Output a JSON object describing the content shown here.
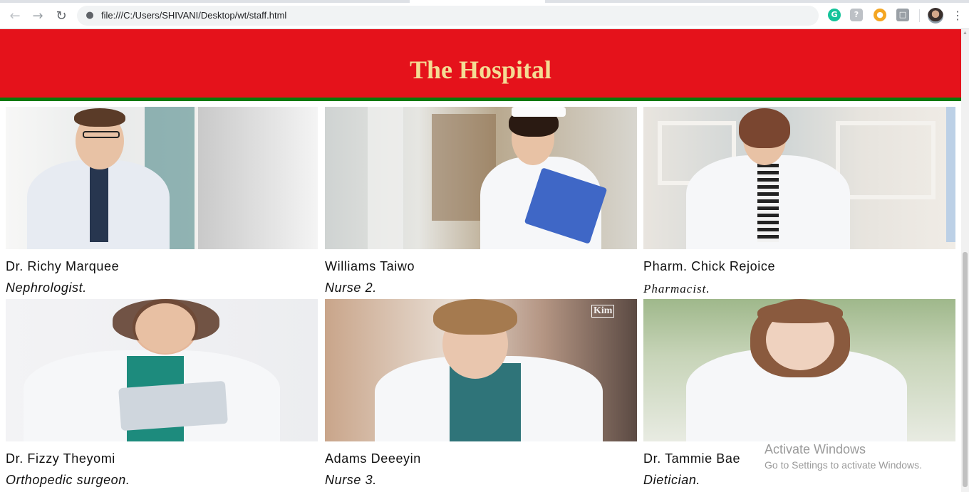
{
  "browser": {
    "url": "file:///C:/Users/SHIVANI/Desktop/wt/staff.html",
    "extensions": [
      "grammarly-icon",
      "shield-extension-icon",
      "cookie-extension-icon",
      "copy-extension-icon"
    ]
  },
  "page": {
    "title": "The Hospital",
    "colors": {
      "header_bg": "#e5121b",
      "header_text": "#f4dc94",
      "header_border": "#0a7a0a"
    }
  },
  "staff": [
    {
      "name": "Dr. Richy Marquee",
      "role": "Nephrologist."
    },
    {
      "name": "Williams Taiwo",
      "role": "Nurse 2."
    },
    {
      "name": "Pharm. Chick Rejoice",
      "role": "Pharmacist."
    },
    {
      "name": "Dr. Fizzy Theyomi",
      "role": "Orthopedic surgeon."
    },
    {
      "name": "Adams Deeeyin",
      "role": "Nurse 3."
    },
    {
      "name": "Dr. Tammie Bae",
      "role": "Dietician."
    }
  ],
  "watermarks": {
    "photo5": "Kim"
  },
  "os_overlay": {
    "line1": "Activate Windows",
    "line2": "Go to Settings to activate Windows."
  }
}
